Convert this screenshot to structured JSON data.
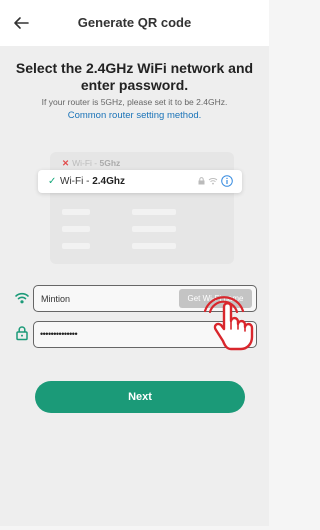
{
  "header": {
    "title": "Generate QR code"
  },
  "main": {
    "heading": "Select the 2.4GHz WiFi network and enter password.",
    "subtext": "If your router is 5GHz, please set it to be 2.4GHz.",
    "link": "Common router setting method."
  },
  "illustration": {
    "wrong": {
      "prefix": "Wi-Fi - ",
      "band": "5Ghz"
    },
    "right": {
      "prefix": "Wi-Fi - ",
      "band": "2.4Ghz"
    }
  },
  "form": {
    "ssid_value": "Mintion",
    "get_wifi_label": "Get Wi-Fi name",
    "password_value": "••••••••••••••"
  },
  "actions": {
    "next_label": "Next"
  },
  "colors": {
    "accent": "#1b9a78",
    "link": "#1a73b8",
    "error": "#e24a4a",
    "hand": "#d9262c"
  }
}
